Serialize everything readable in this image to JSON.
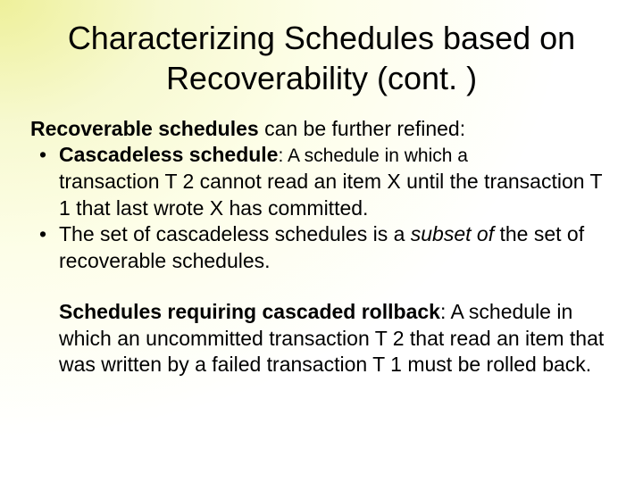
{
  "title": "Characterizing Schedules based on Recoverability (cont. )",
  "intro_bold": "Recoverable schedules",
  "intro_rest": " can be further refined:",
  "bullet1_term": "Cascadeless schedule",
  "bullet1_colon": ": ",
  "bullet1_def_small": "A schedule in which a",
  "bullet1_cont": "transaction T 2 cannot read an item X until the transaction T 1 that last wrote X has committed.",
  "bullet2_a": "The set of cascadeless schedules is a ",
  "bullet2_italic": "subset of ",
  "bullet2_b": "the set of recoverable schedules.",
  "para2_term": "Schedules requiring cascaded rollback",
  "para2_rest": ": A schedule in which an uncommitted transaction T 2 that read an item that was written by a failed transaction T 1 must be rolled back."
}
